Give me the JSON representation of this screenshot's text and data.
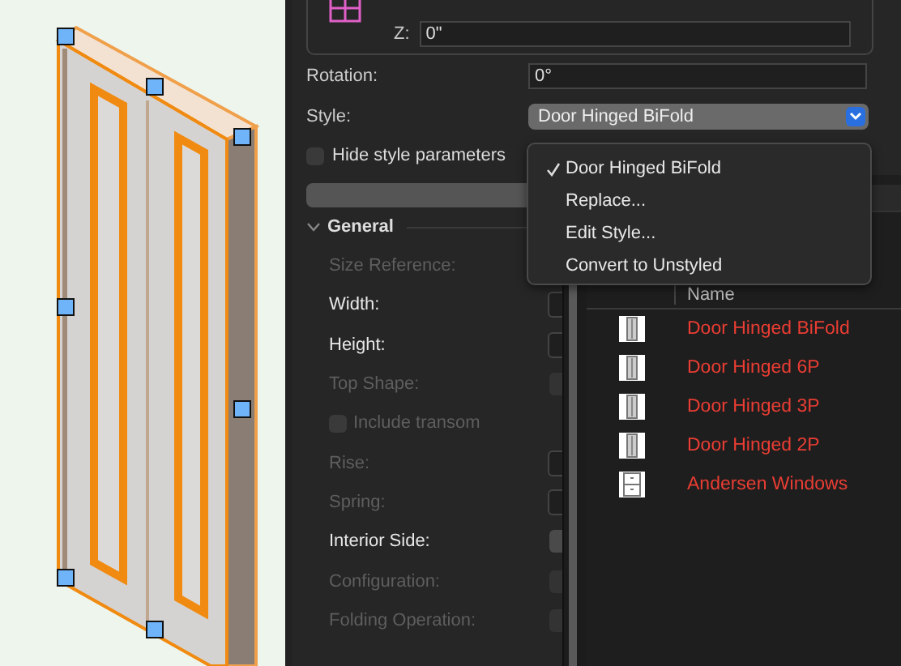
{
  "coordinates": {
    "label": "Z:",
    "value": "0\""
  },
  "properties": [
    {
      "label": "Rotation:",
      "value": "0°",
      "kind": "field"
    },
    {
      "label": "Style:",
      "value": "Door Hinged BiFold",
      "kind": "dropdown"
    }
  ],
  "hide_style_parameters": {
    "label": "Hide style parameters",
    "checked": false
  },
  "style_menu": {
    "items": [
      {
        "label": "Door Hinged BiFold",
        "checked": true
      },
      {
        "label": "Replace...",
        "checked": false
      },
      {
        "label": "Edit Style...",
        "checked": false
      },
      {
        "label": "Convert to Unstyled",
        "checked": false
      }
    ]
  },
  "general": {
    "title": "General",
    "expanded": true,
    "rows": [
      {
        "label": "Size Reference:",
        "kind": "label",
        "disabled": true
      },
      {
        "label": "Width:",
        "kind": "field",
        "disabled": false
      },
      {
        "label": "Height:",
        "kind": "field",
        "disabled": false
      },
      {
        "label": "Top Shape:",
        "kind": "dropdown",
        "disabled": true
      },
      {
        "label": "Include transom",
        "kind": "checkbox",
        "disabled": true,
        "checked": false
      },
      {
        "label": "Rise:",
        "kind": "field",
        "disabled": true
      },
      {
        "label": "Spring:",
        "kind": "field",
        "disabled": true
      },
      {
        "label": "Interior Side:",
        "kind": "dropdown",
        "disabled": false
      },
      {
        "label": "Configuration:",
        "kind": "dropdown",
        "disabled": true
      },
      {
        "label": "Folding Operation:",
        "kind": "dropdown",
        "disabled": true
      }
    ]
  },
  "resources": {
    "columns": [
      "Name"
    ],
    "rows": [
      {
        "name": "Door Hinged BiFold",
        "kind": "door"
      },
      {
        "name": "Door Hinged 6P",
        "kind": "door"
      },
      {
        "name": "Door Hinged 3P",
        "kind": "door"
      },
      {
        "name": "Door Hinged 2P",
        "kind": "door"
      },
      {
        "name": "Andersen Windows",
        "kind": "window"
      }
    ]
  }
}
